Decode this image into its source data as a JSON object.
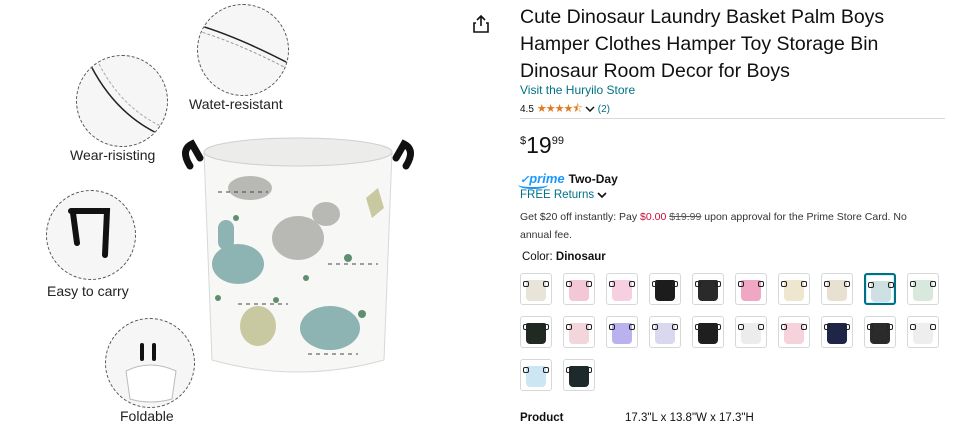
{
  "gallery": {
    "callouts": [
      {
        "label": "Watet-resistant"
      },
      {
        "label": "Wear-risisting"
      },
      {
        "label": "Easy to carry"
      },
      {
        "label": "Foldable"
      }
    ]
  },
  "product": {
    "title": "Cute Dinosaur Laundry Basket Palm Boys Hamper Clothes Hamper Toy Storage Bin Dinosaur Room Decor for Boys",
    "store_link": "Visit the Huryilo Store",
    "rating": "4.5",
    "stars": "★★★★⯪",
    "rating_count": "(2)",
    "price": {
      "symbol": "$",
      "whole": "19",
      "fraction": "99"
    },
    "prime": {
      "logo": "prime",
      "shipping": "Two-Day"
    },
    "returns": "FREE Returns",
    "promo": {
      "pre": "Get $20 off instantly: Pay ",
      "pay": "$0.00",
      "strike": "$19.99",
      "post": " upon approval for the Prime Store Card. No annual fee."
    },
    "color_label": "Color:",
    "color_value": "Dinosaur",
    "swatches": [
      {
        "name": "swatch-1",
        "color": "#e9e4da",
        "selected": false
      },
      {
        "name": "swatch-2",
        "color": "#f2c8d6",
        "selected": false
      },
      {
        "name": "swatch-3",
        "color": "#f6cfe0",
        "selected": false
      },
      {
        "name": "swatch-4",
        "color": "#1c1c1c",
        "selected": false
      },
      {
        "name": "swatch-5",
        "color": "#2a2a2a",
        "selected": false
      },
      {
        "name": "swatch-6",
        "color": "#f0a7c3",
        "selected": false
      },
      {
        "name": "swatch-7",
        "color": "#efe6cf",
        "selected": false
      },
      {
        "name": "swatch-8",
        "color": "#e8e1d2",
        "selected": false
      },
      {
        "name": "swatch-9",
        "color": "#cfe0e2",
        "selected": true
      },
      {
        "name": "swatch-10",
        "color": "#d8e8dc",
        "selected": false
      },
      {
        "name": "swatch-11",
        "color": "#202a22",
        "selected": false
      },
      {
        "name": "swatch-12",
        "color": "#f3d6dc",
        "selected": false
      },
      {
        "name": "swatch-13",
        "color": "#b9b2ef",
        "selected": false
      },
      {
        "name": "swatch-14",
        "color": "#d9d8ef",
        "selected": false
      },
      {
        "name": "swatch-15",
        "color": "#1f1f1f",
        "selected": false
      },
      {
        "name": "swatch-16",
        "color": "#ececec",
        "selected": false
      },
      {
        "name": "swatch-17",
        "color": "#f6d3dc",
        "selected": false
      },
      {
        "name": "swatch-18",
        "color": "#1e2547",
        "selected": false
      },
      {
        "name": "swatch-19",
        "color": "#2b2b2b",
        "selected": false
      },
      {
        "name": "swatch-20",
        "color": "#eeeeee",
        "selected": false
      },
      {
        "name": "swatch-21",
        "color": "#cde6f4",
        "selected": false
      },
      {
        "name": "swatch-22",
        "color": "#1d2a2c",
        "selected": false
      }
    ],
    "spec": {
      "key": "Product",
      "value": "17.3\"L x 13.8\"W x 17.3\"H"
    }
  },
  "colors": {
    "link": "#007185",
    "star": "#de7921",
    "prime": "#1a98ff",
    "deal": "#cc0c39"
  }
}
